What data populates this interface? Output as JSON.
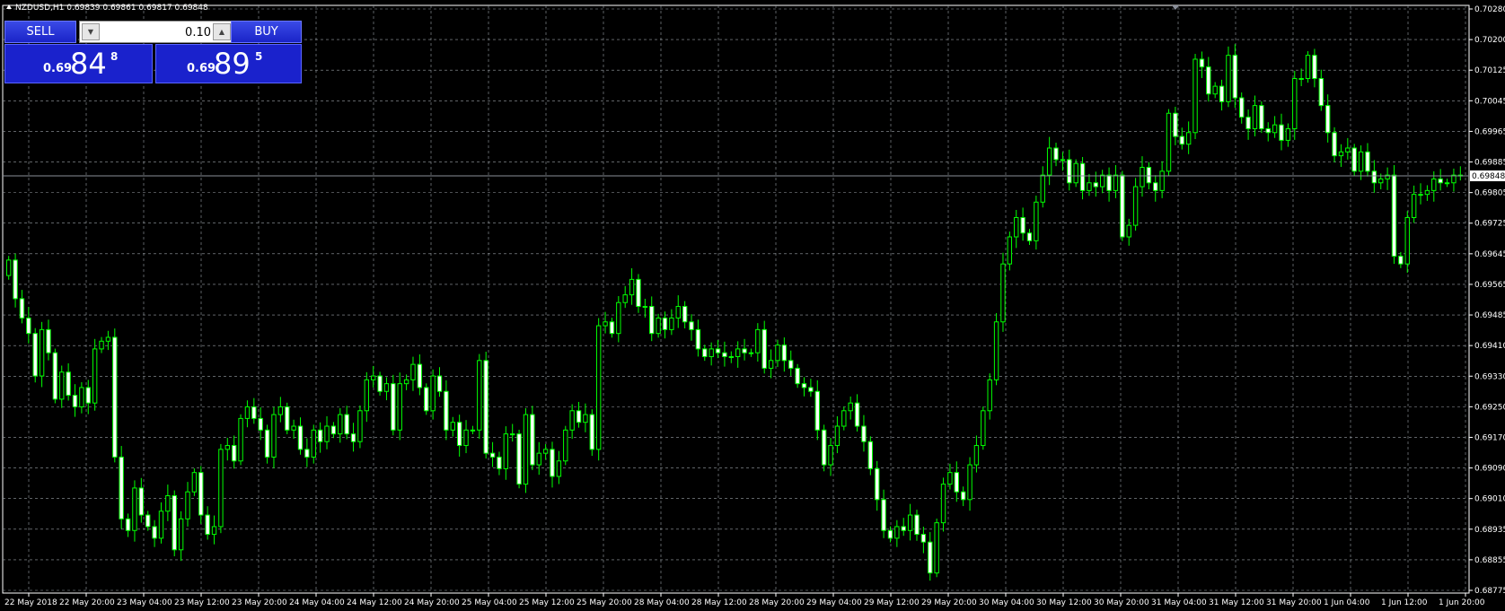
{
  "window": {
    "title": "NZDUSD,H1  0.69839 0.69861 0.69817 0.69848"
  },
  "trade_panel": {
    "sell_label": "SELL",
    "buy_label": "BUY",
    "volume_value": "0.10",
    "sell_price": {
      "prefix": "0.69",
      "big": "84",
      "sup": "8"
    },
    "buy_price": {
      "prefix": "0.69",
      "big": "89",
      "sup": "5"
    },
    "button_color": "#1a22cc"
  },
  "chart_data": {
    "type": "candlestick",
    "symbol": "NZDUSD",
    "timeframe": "H1",
    "current_price": "0.69848",
    "bull_color": "#00ff00",
    "bear_color": "#ffffff",
    "grid": true,
    "y_ticks": [
      "0.70280",
      "0.70200",
      "0.70125",
      "0.70045",
      "0.69965",
      "0.69885",
      "0.69805",
      "0.69725",
      "0.69645",
      "0.69565",
      "0.69485",
      "0.69410",
      "0.69330",
      "0.69250",
      "0.69170",
      "0.69090",
      "0.69010",
      "0.68935",
      "0.68855",
      "0.68775"
    ],
    "ylim": [
      0.68775,
      0.7028
    ],
    "x_ticks": [
      "22 May 2018",
      "22 May 20:00",
      "23 May 04:00",
      "23 May 12:00",
      "23 May 20:00",
      "24 May 04:00",
      "24 May 12:00",
      "24 May 20:00",
      "25 May 04:00",
      "25 May 12:00",
      "25 May 20:00",
      "28 May 04:00",
      "28 May 12:00",
      "28 May 20:00",
      "29 May 04:00",
      "29 May 12:00",
      "29 May 20:00",
      "30 May 04:00",
      "30 May 12:00",
      "30 May 20:00",
      "31 May 04:00",
      "31 May 12:00",
      "31 May 20:00",
      "1 Jun 04:00",
      "1 Jun 12:00",
      "1 Jun 20:00"
    ],
    "closes": [
      0.6963,
      0.6953,
      0.6948,
      0.6944,
      0.6933,
      0.6945,
      0.6939,
      0.6927,
      0.6934,
      0.6928,
      0.6925,
      0.693,
      0.6926,
      0.694,
      0.6942,
      0.6943,
      0.6912,
      0.6896,
      0.6893,
      0.6904,
      0.6897,
      0.6894,
      0.6891,
      0.6898,
      0.6902,
      0.6888,
      0.6896,
      0.6903,
      0.6908,
      0.6897,
      0.6892,
      0.6894,
      0.6914,
      0.6915,
      0.6911,
      0.6922,
      0.6925,
      0.6922,
      0.6919,
      0.6912,
      0.6923,
      0.6925,
      0.6919,
      0.692,
      0.6914,
      0.6912,
      0.6919,
      0.6916,
      0.692,
      0.6918,
      0.6923,
      0.6918,
      0.6916,
      0.6924,
      0.6932,
      0.6933,
      0.6929,
      0.6931,
      0.6919,
      0.6931,
      0.6932,
      0.6936,
      0.693,
      0.6924,
      0.6933,
      0.6929,
      0.6919,
      0.6921,
      0.6915,
      0.6919,
      0.6919,
      0.6937,
      0.6913,
      0.6912,
      0.6909,
      0.6918,
      0.6918,
      0.6905,
      0.6923,
      0.691,
      0.6913,
      0.6914,
      0.6907,
      0.6911,
      0.6919,
      0.6924,
      0.6921,
      0.6923,
      0.6914,
      0.6946,
      0.6947,
      0.6944,
      0.6952,
      0.6954,
      0.6958,
      0.6951,
      0.6951,
      0.6944,
      0.6948,
      0.6945,
      0.6948,
      0.6951,
      0.6947,
      0.6945,
      0.694,
      0.6938,
      0.694,
      0.6939,
      0.6938,
      0.6938,
      0.694,
      0.6939,
      0.6939,
      0.6945,
      0.6935,
      0.6937,
      0.6941,
      0.6937,
      0.6935,
      0.6931,
      0.693,
      0.6929,
      0.6919,
      0.691,
      0.6915,
      0.692,
      0.6924,
      0.6926,
      0.692,
      0.6916,
      0.6909,
      0.6901,
      0.6893,
      0.6891,
      0.6894,
      0.6893,
      0.6897,
      0.6892,
      0.689,
      0.6882,
      0.6895,
      0.6905,
      0.6908,
      0.6903,
      0.6901,
      0.691,
      0.6915,
      0.6924,
      0.6932,
      0.6947,
      0.6962,
      0.6969,
      0.6974,
      0.697,
      0.6968,
      0.6978,
      0.6985,
      0.6992,
      0.6989,
      0.6989,
      0.6983,
      0.6988,
      0.6981,
      0.6983,
      0.6982,
      0.6985,
      0.6981,
      0.6985,
      0.6969,
      0.6972,
      0.6982,
      0.6987,
      0.6983,
      0.6981,
      0.6986,
      0.7001,
      0.6995,
      0.6993,
      0.6996,
      0.7015,
      0.7013,
      0.7006,
      0.7008,
      0.7004,
      0.7016,
      0.7005,
      0.7,
      0.6997,
      0.7003,
      0.6997,
      0.6996,
      0.6998,
      0.6994,
      0.6997,
      0.701,
      0.701,
      0.7016,
      0.701,
      0.7003,
      0.6996,
      0.699,
      0.6991,
      0.6992,
      0.6986,
      0.6991,
      0.6986,
      0.6983,
      0.6984,
      0.6985,
      0.6964,
      0.6962,
      0.6974,
      0.698,
      0.698,
      0.6981,
      0.6984,
      0.6983,
      0.6983,
      0.6985,
      0.6985
    ]
  }
}
